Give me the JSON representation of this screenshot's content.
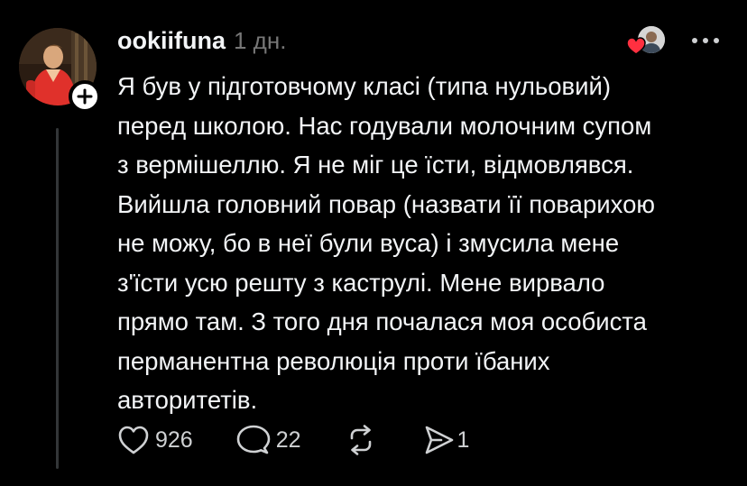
{
  "post": {
    "username": "ookiifuna",
    "timestamp": "1 дн.",
    "body": "Я був у підготовчому класі (типа нульовий)\nперед школою. Нас годували молочним супом\nз вермішеллю. Я не міг це їсти, відмовлявся.\nВийшла головний повар (назвати її поварихою\nне можу, бо в неї були вуса) і змусила мене\nз'їсти усю решту з каструлі. Мене вирвало\nпрямо там. З того дня почалася моя особиста\nперманентна революція проти їбаних\nавторитетів."
  },
  "actions": {
    "likes": "926",
    "replies": "22",
    "shares": "1"
  },
  "icons": {
    "follow": "plus-icon",
    "liked_by": "heart-icon",
    "more": "more-horizontal-icon",
    "like": "heart-outline-icon",
    "reply": "comment-bubble-icon",
    "repost": "repost-icon",
    "share": "send-icon"
  },
  "colors": {
    "background": "#000000",
    "text_primary": "#f3f5f7",
    "text_secondary": "#777777",
    "heart_red": "#ff3040",
    "thread_line": "#333638"
  }
}
